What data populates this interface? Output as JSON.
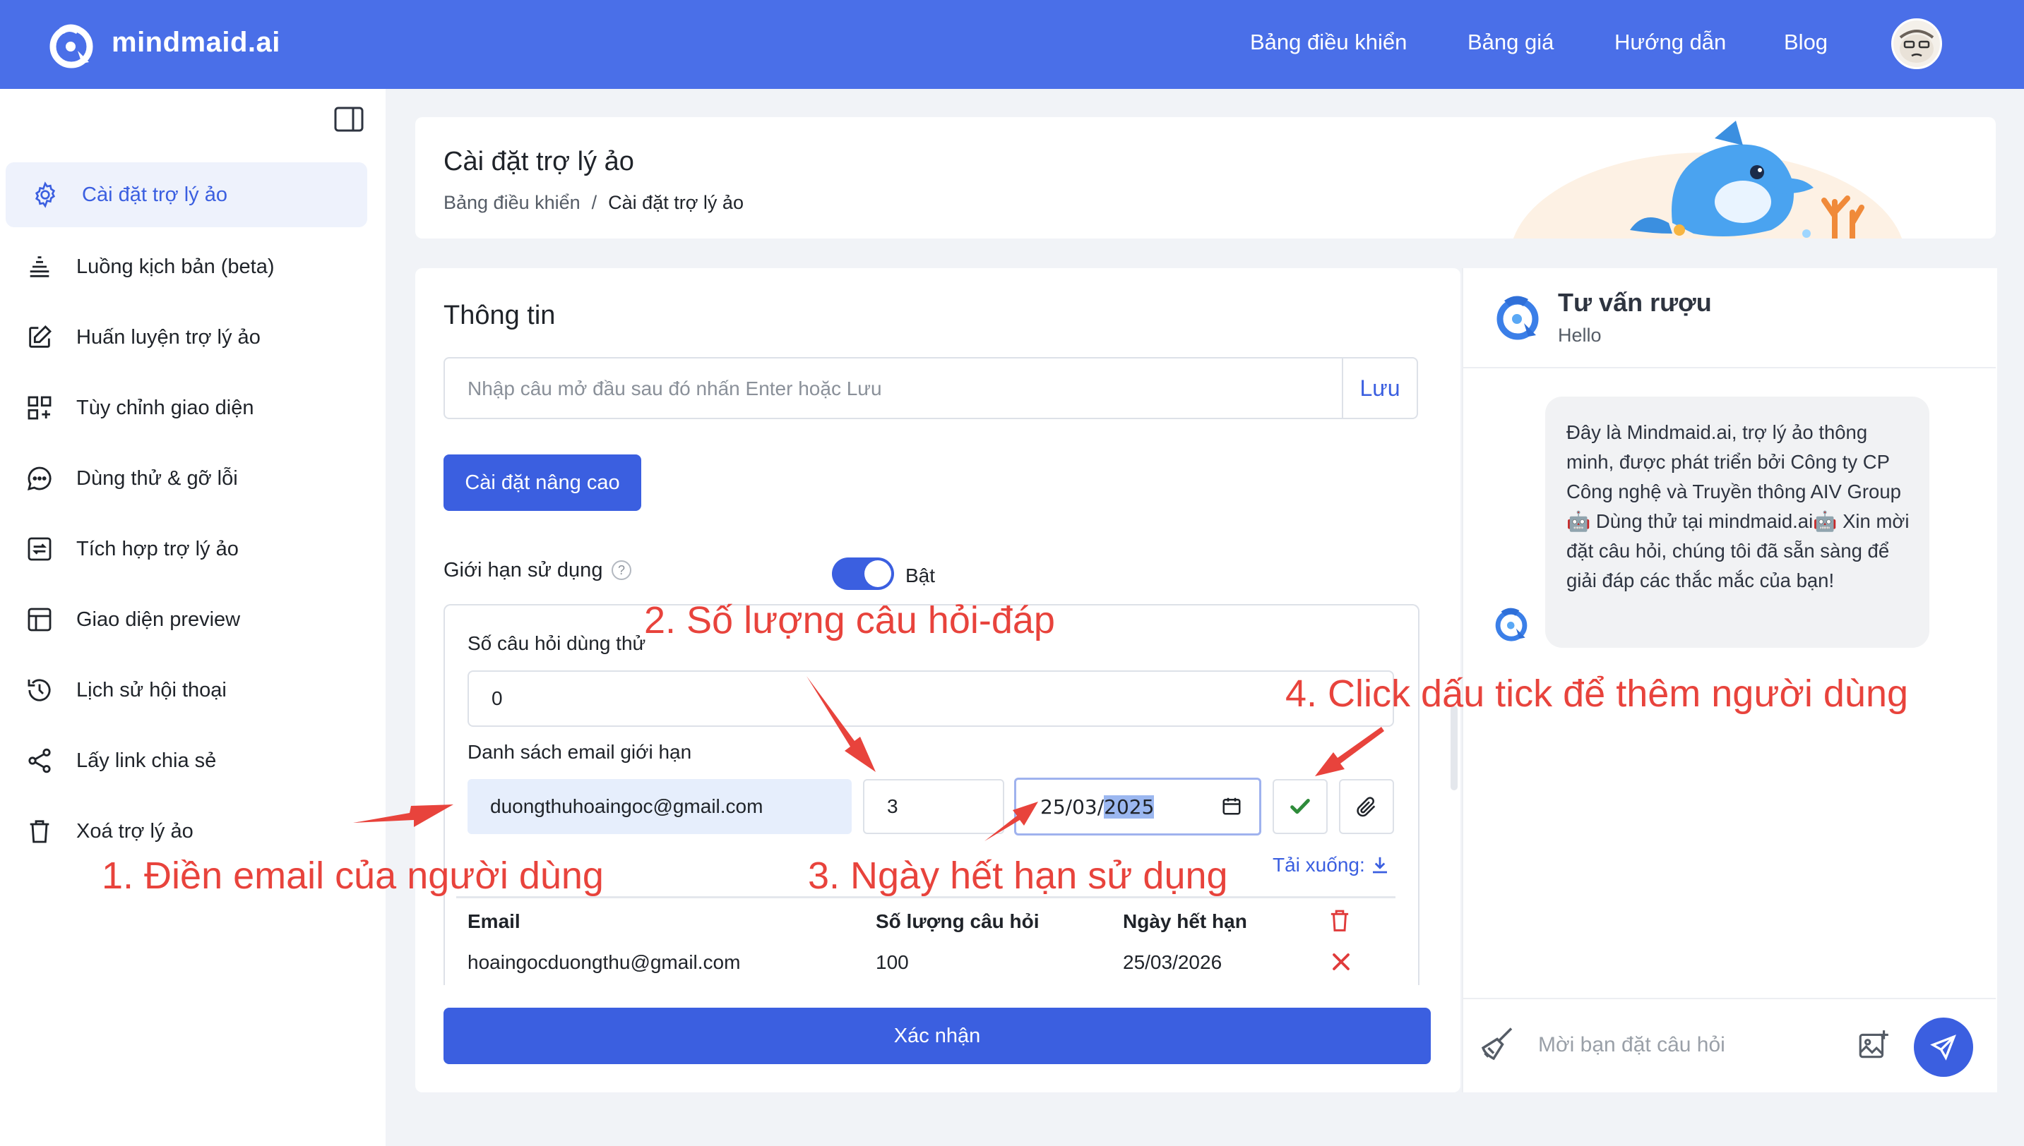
{
  "brand": {
    "name": "mindmaid.ai"
  },
  "nav": [
    "Bảng điều khiển",
    "Bảng giá",
    "Hướng dẫn",
    "Blog"
  ],
  "sidebar": {
    "items": [
      {
        "label": "Cài đặt trợ lý ảo",
        "icon": "gear-icon",
        "active": true
      },
      {
        "label": "Luồng kịch bản (beta)",
        "icon": "stack-icon"
      },
      {
        "label": "Huấn luyện trợ lý ảo",
        "icon": "edit-icon"
      },
      {
        "label": "Tùy chỉnh giao diện",
        "icon": "grid-plus-icon"
      },
      {
        "label": "Dùng thử & gỡ lỗi",
        "icon": "chat-dots-icon"
      },
      {
        "label": "Tích hợp trợ lý ảo",
        "icon": "integration-icon"
      },
      {
        "label": "Giao diện preview",
        "icon": "layout-icon"
      },
      {
        "label": "Lịch sử hội thoại",
        "icon": "history-icon"
      },
      {
        "label": "Lấy link chia sẻ",
        "icon": "share-icon"
      },
      {
        "label": "Xoá trợ lý ảo",
        "icon": "trash-icon"
      }
    ]
  },
  "header": {
    "title": "Cài đặt trợ lý ảo",
    "breadcrumb": [
      "Bảng điều khiển",
      "/",
      "Cài đặt trợ lý ảo"
    ]
  },
  "form": {
    "section_title": "Thông tin",
    "opening_placeholder": "Nhập câu mở đầu sau đó nhấn Enter hoặc Lưu",
    "save_label": "Lưu",
    "advanced_label": "Cài đặt nâng cao",
    "limit_label": "Giới hạn sử dụng",
    "help": "?",
    "toggle_label": "Bật",
    "toggle_on": true,
    "trial_label": "Số câu hỏi dùng thử",
    "trial_value": "0",
    "email_list_label": "Danh sách email giới hạn",
    "email_value": "duongthuhoaingoc@gmail.com",
    "qty_value": "3",
    "date_day_month": "25/03/",
    "date_year": "2025",
    "download_label": "Tải xuống:",
    "table": {
      "headers": [
        "Email",
        "Số lượng câu hỏi",
        "Ngày hết hạn"
      ],
      "rows": [
        [
          "hoaingocduongthu@gmail.com",
          "100",
          "25/03/2026"
        ]
      ]
    },
    "confirm_label": "Xác nhận"
  },
  "chat": {
    "name": "Tư vấn rượu",
    "status": "Hello",
    "message": "Đây là Mindmaid.ai, trợ lý ảo thông minh, được phát triển bởi Công ty CP Công nghệ và Truyền thông AIV Group 🤖 Dùng thử tại mindmaid.ai🤖 Xin mời đặt câu hỏi, chúng tôi đã sẵn sàng để giải đáp các thắc mắc của bạn!",
    "input_placeholder": "Mời bạn đặt câu hỏi"
  },
  "annotations": [
    "1. Điền email của người dùng",
    "2. Số lượng câu hỏi-đáp",
    "3. Ngày hết hạn sử dụng",
    "4. Click dấu tick để thêm người dùng"
  ],
  "colors": {
    "primary": "#3b5fe0",
    "topbar": "#4a6fe8",
    "annotation": "#e8433c",
    "success": "#2e8b3a",
    "danger": "#e03b3b"
  }
}
